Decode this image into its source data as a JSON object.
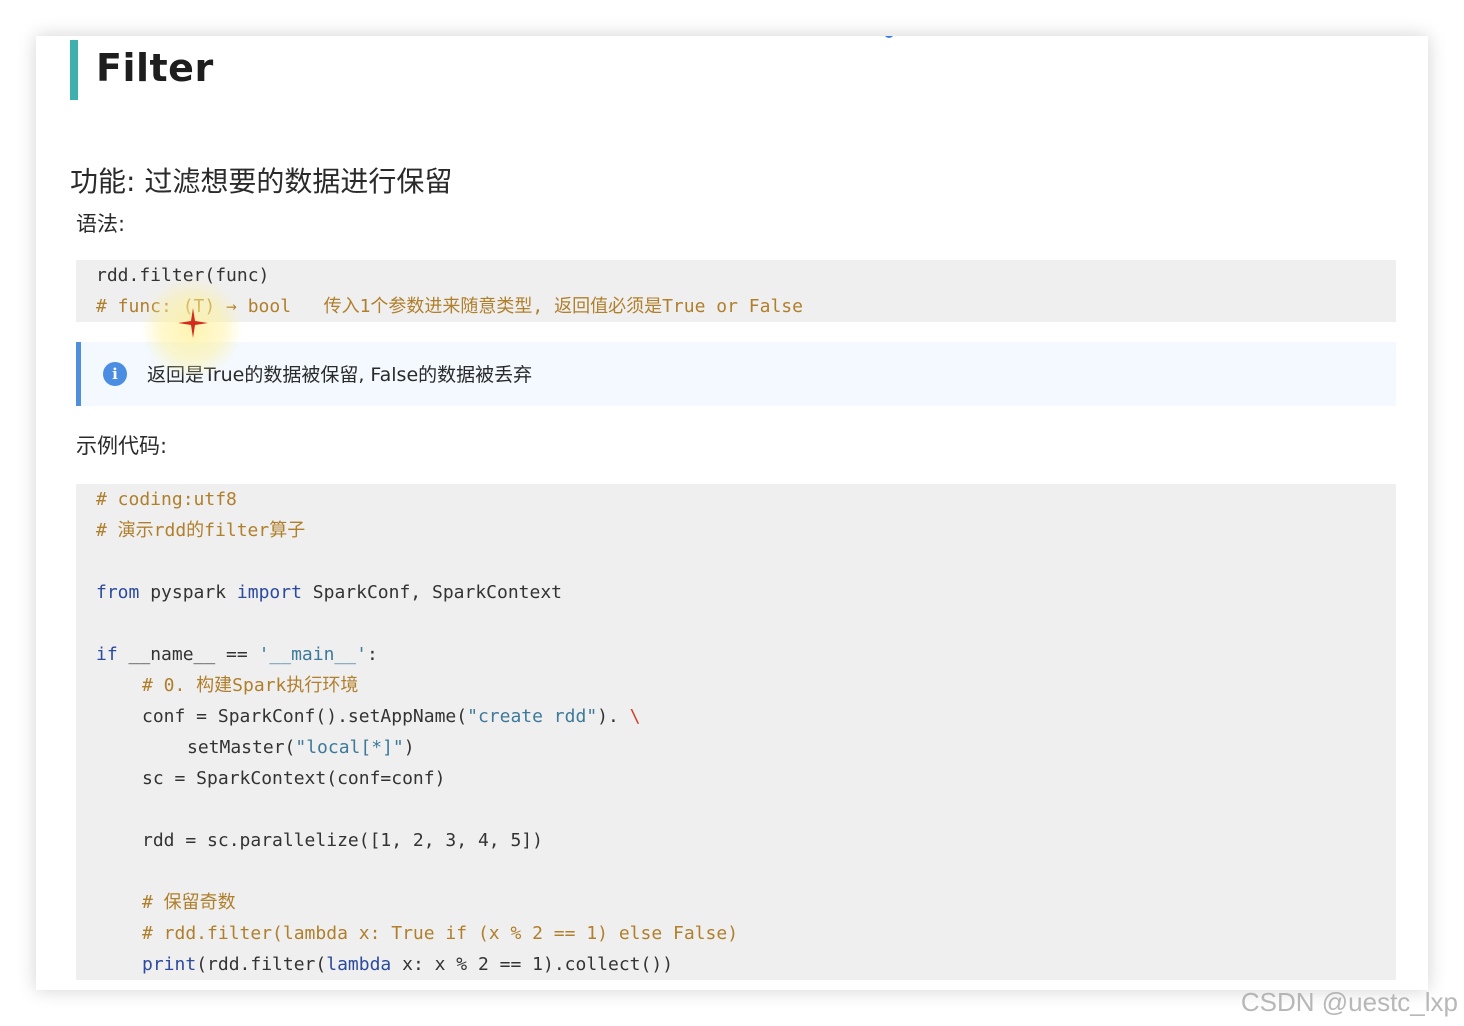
{
  "title": "Filter",
  "function_line": "功能: 过滤想要的数据进行保留",
  "syntax_label": "语法:",
  "syntax_code": [
    "rdd.filter(func)",
    "# func: (T) → bool   传入1个参数进来随意类型, 返回值必须是True or False"
  ],
  "info": {
    "icon": "info-icon",
    "text": "返回是True的数据被保留, False的数据被丢弃"
  },
  "example_label": "示例代码:",
  "example_code": {
    "l1": "# coding:utf8",
    "l2": "# 演示rdd的filter算子",
    "l3_kw1": "from",
    "l3_a": " pyspark ",
    "l3_kw2": "import",
    "l3_b": " SparkConf, SparkContext",
    "l4_kw": "if",
    "l4_a": " __name__ == ",
    "l4_str": "'__main__'",
    "l4_b": ":",
    "l5": "# 0. 构建Spark执行环境",
    "l6_a": "conf = SparkConf().setAppName(",
    "l6_str": "\"create rdd\"",
    "l6_b": "). ",
    "l6_esc": "\\",
    "l7_a": "setMaster(",
    "l7_str": "\"local[*]\"",
    "l7_b": ")",
    "l8": "sc = SparkContext(conf=conf)",
    "l9": "rdd = sc.parallelize([1, 2, 3, 4, 5])",
    "l10": "# 保留奇数",
    "l11": "# rdd.filter(lambda x: True if (x % 2 == 1) else False)",
    "l12_kw": "print",
    "l12_a": "(rdd.filter(",
    "l12_kw2": "lambda",
    "l12_b": " x: x % 2 == 1).collect())"
  },
  "watermark": "CSDN @uestc_lxp",
  "colors": {
    "accent_bar": "#3fb0ad",
    "info_border": "#4f8fdb",
    "comment": "#b07f2c",
    "keyword": "#2c4a9e",
    "string": "#3d7a9a"
  }
}
